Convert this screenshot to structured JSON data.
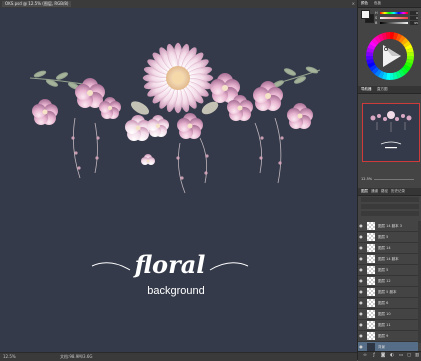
{
  "document": {
    "tab_title": "OKS.psd @ 12.5% (图层, RGB/8)",
    "close_glyph": "×",
    "background_color": "#343a4a",
    "artwork": {
      "title_script": "floral",
      "subtitle": "background"
    }
  },
  "status_bar": {
    "zoom": "12.5%",
    "doc_info": "文档:98.9M/3.6G"
  },
  "panel": {
    "color_tabs": [
      "颜色",
      "色板"
    ],
    "foreground_color": "#f2f2f2",
    "background_color": "#1c1c1c",
    "sliders": [
      {
        "label": "H",
        "value": "0"
      },
      {
        "label": "S",
        "value": "0"
      },
      {
        "label": "B",
        "value": "95"
      }
    ],
    "navigator_tabs": [
      "导航器",
      "直方图"
    ],
    "navigator_zoom": "12.5%",
    "layers_tabs": [
      "图层",
      "通道",
      "路径",
      "历史记录"
    ],
    "layers": [
      {
        "name": "图层 14 副本 3"
      },
      {
        "name": "图层 5"
      },
      {
        "name": "图层 14"
      },
      {
        "name": "图层 14 副本"
      },
      {
        "name": "图层 5"
      },
      {
        "name": "图层 12"
      },
      {
        "name": "图层 5 副本"
      },
      {
        "name": "图层 6"
      },
      {
        "name": "图层 10"
      },
      {
        "name": "图层 11"
      },
      {
        "name": "图层 9"
      },
      {
        "name": "背景"
      }
    ]
  }
}
